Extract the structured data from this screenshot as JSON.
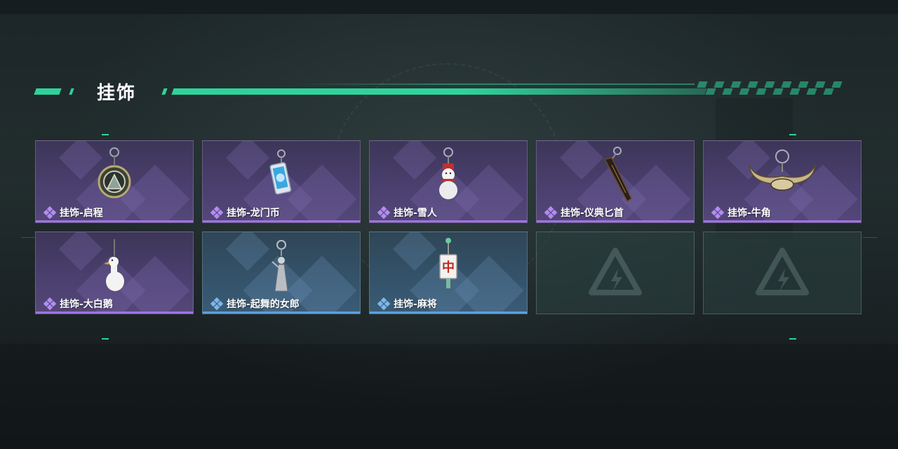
{
  "section": {
    "title": "挂饰"
  },
  "colors": {
    "accent": "#2ed39a",
    "rarity_purple": "#a072e6",
    "rarity_blue": "#5aa0e0"
  },
  "cards": [
    {
      "label": "挂饰-启程",
      "rarity": "purple",
      "icon": "medallion-charm-icon"
    },
    {
      "label": "挂饰-龙门币",
      "rarity": "purple",
      "icon": "coin-card-charm-icon"
    },
    {
      "label": "挂饰-雪人",
      "rarity": "purple",
      "icon": "snowman-charm-icon"
    },
    {
      "label": "挂饰-仪典匕首",
      "rarity": "purple",
      "icon": "dagger-charm-icon"
    },
    {
      "label": "挂饰-牛角",
      "rarity": "purple",
      "icon": "bull-horns-charm-icon"
    },
    {
      "label": "挂饰-大白鹅",
      "rarity": "purple",
      "icon": "white-goose-charm-icon"
    },
    {
      "label": "挂饰-起舞的女郎",
      "rarity": "blue",
      "icon": "dancing-lady-charm-icon"
    },
    {
      "label": "挂饰-麻将",
      "rarity": "blue",
      "icon": "mahjong-tile-charm-icon"
    },
    {
      "label": "",
      "rarity": "empty",
      "icon": "empty-slot-logo-icon"
    },
    {
      "label": "",
      "rarity": "empty",
      "icon": "empty-slot-logo-icon"
    }
  ],
  "mahjong_glyph": "中"
}
